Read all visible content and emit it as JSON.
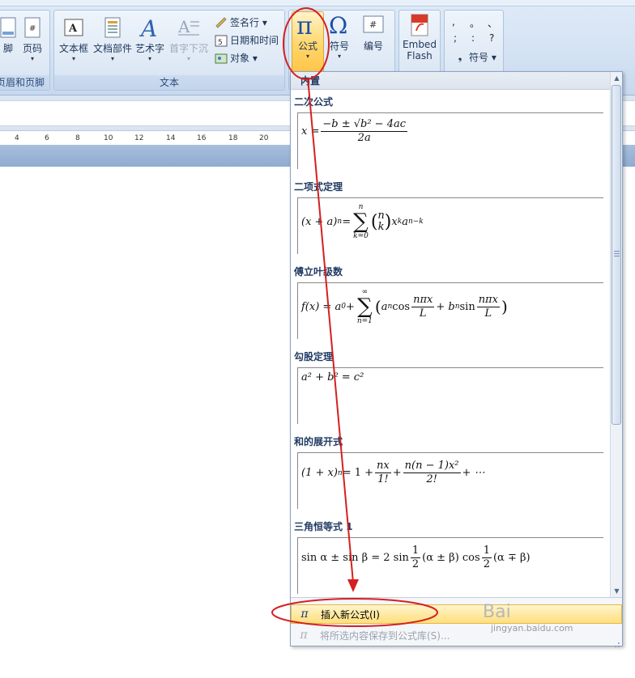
{
  "ribbon": {
    "group_header_footer": {
      "label": "页眉和页脚",
      "button_footer": "脚",
      "button_page_number": "页码"
    },
    "group_text": {
      "label": "文本",
      "text_box": "文本框",
      "doc_parts": "文档部件",
      "wordart": "艺术字",
      "drop_cap": "首字下沉",
      "signature_line": "签名行 ▾",
      "date_time": "日期和时间",
      "object": "对象 ▾"
    },
    "group_symbols": {
      "formula": "公式",
      "symbol": "符号",
      "numbering": "编号"
    },
    "group_flash": {
      "embed_line1": "Embed",
      "embed_line2": "Flash"
    },
    "group_special": {
      "symbol_dropdown": "符号 ▾",
      "marks": [
        ", ",
        "。",
        "、",
        ";",
        ":",
        "?"
      ]
    }
  },
  "ruler": {
    "ticks": [
      "4",
      "6",
      "8",
      "10",
      "12",
      "14",
      "16",
      "18",
      "20"
    ]
  },
  "gallery": {
    "header": "内置",
    "entries": [
      {
        "title": "二次公式"
      },
      {
        "title": "二项式定理"
      },
      {
        "title": "傅立叶级数"
      },
      {
        "title": "勾股定理"
      },
      {
        "title": "和的展开式"
      },
      {
        "title": "三角恒等式 1"
      }
    ],
    "equations": {
      "quadratic": {
        "lhs": "x = ",
        "num": "−b ± √b² − 4ac",
        "den": "2a"
      },
      "binomial": {
        "lhs": "(x + a)",
        "sup_n": "n",
        "eq": " = ",
        "sum_top": "n",
        "sum_bot": "k=0",
        "binom_top": "n",
        "binom_bot": "k",
        "rest": "x",
        "sup_k": "k",
        "a": "a",
        "sup_nk": "n−k"
      },
      "fourier": {
        "lhs": "f(x) = a",
        "sub0": "0",
        "plus": " + ",
        "sum_top": "∞",
        "sum_bot": "n=1",
        "a_n": "a",
        "sub_n": "n",
        "cos": " cos ",
        "frac_num": "nπx",
        "frac_den": "L",
        "plus2": " + b",
        "sub_n2": "n",
        "sin": " sin ",
        "frac2_num": "nπx",
        "frac2_den": "L"
      },
      "pythagorean": {
        "text": "a² + b² = c²"
      },
      "expansion": {
        "lhs": "(1 + x)",
        "sup_n": "n",
        "eq": " = 1 + ",
        "f1_num": "nx",
        "f1_den": "1!",
        "plus": " + ",
        "f2_num": "n(n − 1)x²",
        "f2_den": "2!",
        "tail": " + ⋯"
      },
      "trig": {
        "lhs": "sin α ± sin β = 2 sin ",
        "f1_num": "1",
        "f1_den": "2",
        "mid": "(α ± β) cos ",
        "f2_num": "1",
        "f2_den": "2",
        "tail": "(α ∓ β)"
      }
    },
    "footer": {
      "insert_new": "插入新公式(I)",
      "save_selection": "将所选内容保存到公式库(S)..."
    }
  },
  "watermark": {
    "logo": "Bai",
    "site": "jingyan.baidu.com"
  },
  "colors": {
    "annotation_red": "#d42020",
    "highlight": "#ffd66b"
  }
}
